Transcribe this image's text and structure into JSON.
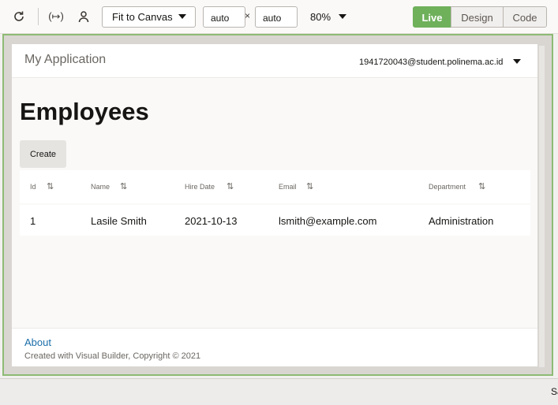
{
  "toolbar": {
    "icons": [
      "refresh-icon",
      "variable-icon",
      "user-icon"
    ],
    "variable_glyph": "(↦)",
    "fit_select": "Fit to Canvas",
    "width_value": "auto",
    "height_value": "auto",
    "times": "×",
    "zoom": "80%",
    "modes": [
      "Live",
      "Design",
      "Code"
    ],
    "active_mode": "Live",
    "accent_color": "#6fb05b"
  },
  "app": {
    "title": "My Application",
    "user": "1941720043@student.polinema.ac.id",
    "page_title": "Employees",
    "create_label": "Create",
    "table": {
      "columns": [
        "Id",
        "Name",
        "Hire Date",
        "Email",
        "Department"
      ],
      "sort_glyph": "⇅",
      "rows": [
        [
          "1",
          "Lasile Smith",
          "2021-10-13",
          "lsmith@example.com",
          "Administration"
        ]
      ]
    },
    "footer": {
      "about": "About",
      "copyright": "Created with Visual Builder, Copyright © 2021"
    }
  },
  "statusbar": {
    "text": "Sa"
  }
}
